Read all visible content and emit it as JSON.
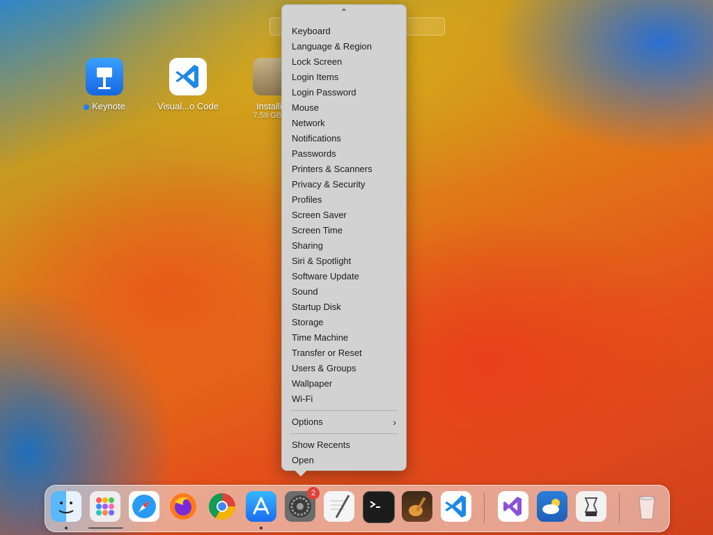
{
  "desktop": {
    "icons": [
      {
        "label": "Keynote"
      },
      {
        "label": "Visual...o Code"
      },
      {
        "label": "Installin",
        "sub": "7.59 GB of"
      }
    ]
  },
  "menu": {
    "items": [
      "Keyboard",
      "Language & Region",
      "Lock Screen",
      "Login Items",
      "Login Password",
      "Mouse",
      "Network",
      "Notifications",
      "Passwords",
      "Printers & Scanners",
      "Privacy & Security",
      "Profiles",
      "Screen Saver",
      "Screen Time",
      "Sharing",
      "Siri & Spotlight",
      "Software Update",
      "Sound",
      "Startup Disk",
      "Storage",
      "Time Machine",
      "Transfer or Reset",
      "Users & Groups",
      "Wallpaper",
      "Wi-Fi"
    ],
    "options_label": "Options",
    "show_recents": "Show Recents",
    "open": "Open"
  },
  "dock": {
    "settings_badge": "2",
    "apps": [
      "finder-icon",
      "launchpad-icon",
      "safari-icon",
      "firefox-icon",
      "chrome-icon",
      "app-store-icon",
      "system-settings-icon",
      "textedit-icon",
      "terminal-icon",
      "garageband-icon",
      "vscode-icon",
      "visual-studio-icon",
      "weather-icon",
      "archive-utility-icon",
      "trash-icon"
    ]
  },
  "colors": {
    "menu_bg": "#d2d2d2",
    "accent_blue": "#1f7bff",
    "badge_red": "#e0413a"
  }
}
